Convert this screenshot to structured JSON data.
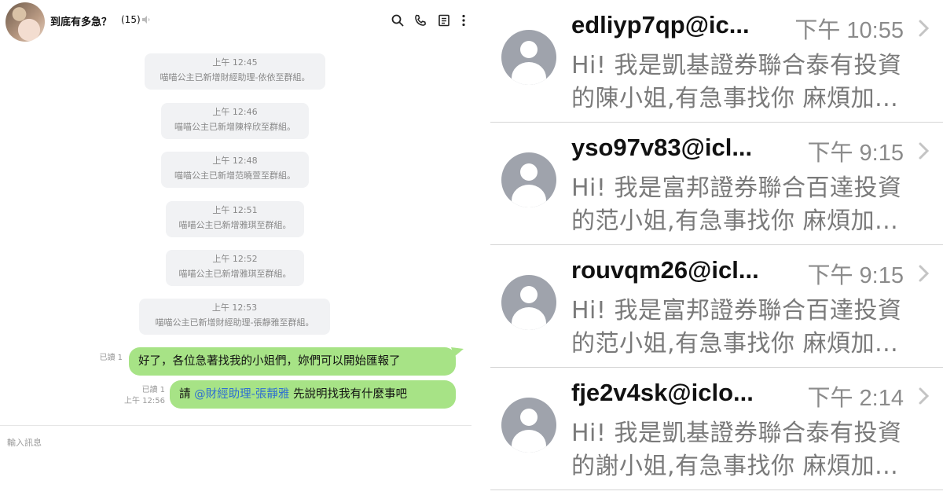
{
  "chat": {
    "title": "到底有多急？",
    "member_count": "(15)",
    "system_messages": [
      {
        "time": "上午 12:45",
        "text": "喵喵公主已新增財經助理-依依至群組。"
      },
      {
        "time": "上午 12:46",
        "text": "喵喵公主已新增陳梓欣至群組。"
      },
      {
        "time": "上午 12:48",
        "text": "喵喵公主已新增范曉萱至群組。"
      },
      {
        "time": "上午 12:51",
        "text": "喵喵公主已新增雅琪至群組。"
      },
      {
        "time": "上午 12:52",
        "text": "喵喵公主已新增雅琪至群組。"
      },
      {
        "time": "上午 12:53",
        "text": "喵喵公主已新增財經助理-張靜雅至群組。"
      }
    ],
    "messages": [
      {
        "read": "已讀 1",
        "text": "好了，各位急著找我的小姐們，妳們可以開始匯報了"
      },
      {
        "read": "已讀 1",
        "time": "上午 12:56",
        "prefix": "請 ",
        "mention": "@財經助理-張靜雅",
        "suffix": " 先說明找我有什麼事吧"
      }
    ],
    "input_placeholder": "輸入訊息"
  },
  "sms": {
    "rows": [
      {
        "sender": "edliyp7qp@ic...",
        "time": "下午 10:55",
        "line1": "Hi! 我是凱基證券聯合泰有投資",
        "line2": "的陳小姐,有急事找你 麻煩加..."
      },
      {
        "sender": "yso97v83@icl...",
        "time": "下午 9:15",
        "line1": "Hi! 我是富邦證券聯合百達投資",
        "line2": "的范小姐,有急事找你 麻煩加..."
      },
      {
        "sender": "rouvqm26@icl...",
        "time": "下午 9:15",
        "line1": "Hi! 我是富邦證券聯合百達投資",
        "line2": "的范小姐,有急事找你 麻煩加..."
      },
      {
        "sender": "fje2v4sk@iclo...",
        "time": "下午 2:14",
        "line1": "Hi! 我是凱基證券聯合泰有投資",
        "line2": "的謝小姐,有急事找你 麻煩加..."
      }
    ]
  },
  "colors": {
    "bubble": "#a7e386",
    "system_bg": "#f1f2f4",
    "mention": "#2f6fd1",
    "contact_avatar": "#9fa3ac"
  },
  "icons": [
    "search-icon",
    "phone-icon",
    "notes-icon",
    "more-icon",
    "mute-icon",
    "chevron-right-icon",
    "contact-placeholder-icon"
  ]
}
